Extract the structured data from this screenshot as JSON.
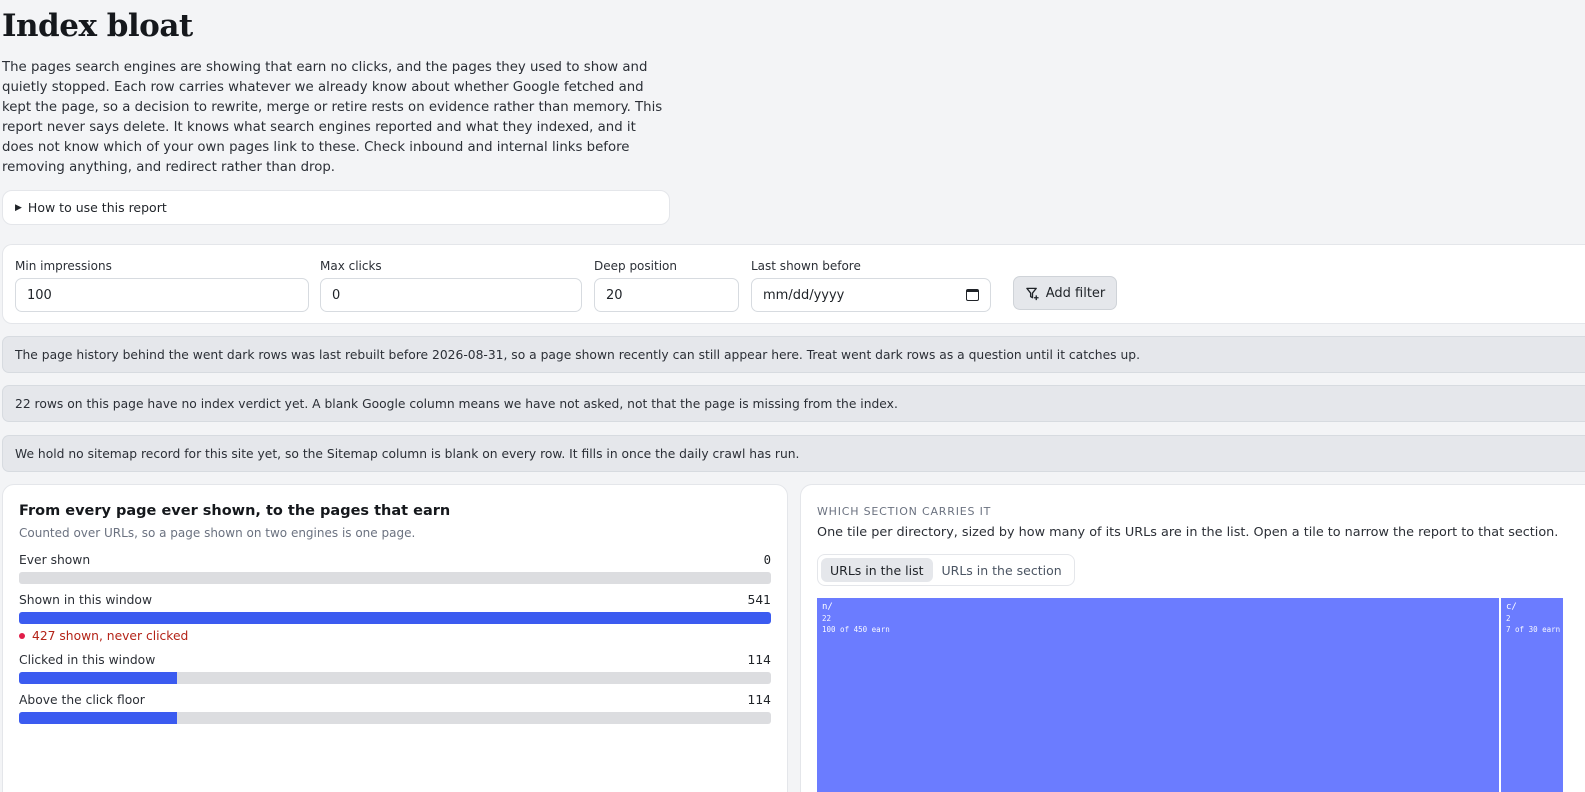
{
  "page": {
    "title": "Index bloat",
    "intro": "The pages search engines are showing that earn no clicks, and the pages they used to show and quietly stopped. Each row carries whatever we already know about whether Google fetched and kept the page, so a decision to rewrite, merge or retire rests on evidence rather than memory. This report never says delete. It knows what search engines reported and what they indexed, and it does not know which of your own pages link to these. Check inbound and internal links before removing anything, and redirect rather than drop.",
    "howto_label": "How to use this report"
  },
  "filters": {
    "min_impressions": {
      "label": "Min impressions",
      "value": "100"
    },
    "max_clicks": {
      "label": "Max clicks",
      "value": "0"
    },
    "deep_position": {
      "label": "Deep position",
      "value": "20"
    },
    "last_shown_before": {
      "label": "Last shown before",
      "placeholder": "mm/dd/yyyy"
    },
    "add_filter_label": "Add filter"
  },
  "notices": [
    "The page history behind the went dark rows was last rebuilt before 2026-08-31, so a page shown recently can still appear here. Treat went dark rows as a question until it catches up.",
    "22 rows on this page have no index verdict yet. A blank Google column means we have not asked, not that the page is missing from the index.",
    "We hold no sitemap record for this site yet, so the Sitemap column is blank on every row. It fills in once the daily crawl has run."
  ],
  "funnel": {
    "title": "From every page ever shown, to the pages that earn",
    "subtitle": "Counted over URLs, so a page shown on two engines is one page.",
    "rows": [
      {
        "label": "Ever shown",
        "value": "0",
        "fraction": 0
      },
      {
        "label": "Shown in this window",
        "value": "541",
        "fraction": 1.0
      },
      {
        "label": "Clicked in this window",
        "value": "114",
        "fraction": 0.21
      },
      {
        "label": "Above the click floor",
        "value": "114",
        "fraction": 0.21
      }
    ],
    "warning": "427 shown, never clicked",
    "bar_color": "#3b5bf0",
    "warning_color": "#b42318"
  },
  "sections": {
    "eyebrow": "WHICH SECTION CARRIES IT",
    "subtitle": "One tile per directory, sized by how many of its URLs are in the list. Open a tile to narrow the report to that section.",
    "tabs": [
      "URLs in the list",
      "URLs in the section"
    ],
    "active_tab": 0,
    "tiles": [
      {
        "name": "n/",
        "count": "22",
        "earn": "100 of 450 earn",
        "share": 22
      },
      {
        "name": "c/",
        "count": "2",
        "earn": "7 of 30 earn",
        "share": 2
      }
    ],
    "tile_color": "#6b7cff"
  }
}
